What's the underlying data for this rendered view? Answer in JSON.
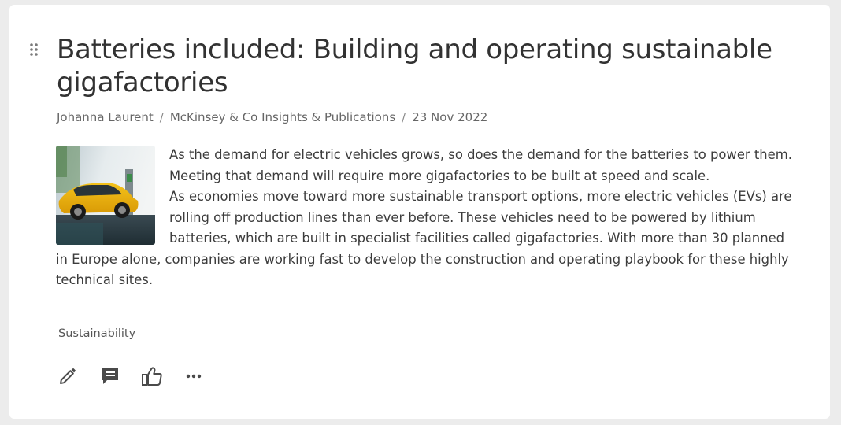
{
  "article": {
    "title": "Batteries included: Building and operating sustainable gigafactories",
    "meta": {
      "author": "Johanna Laurent",
      "source": "McKinsey & Co Insights & Publications",
      "date": "23 Nov 2022",
      "separator": "/"
    },
    "summary": "As the demand for electric vehicles grows, so does the demand for the batteries to power them. Meeting that demand will require more gigafactories to be built at speed and scale.",
    "body": "As economies move toward more sustainable transport options, more electric vehicles (EVs) are rolling off production lines than ever before. These vehicles need to be powered by lithium batteries, which are built in specialist facilities called gigafactories. With more than 30 planned in Europe alone, companies are working fast to develop the construction and operating playbook for these highly technical sites.",
    "tag": "Sustainability",
    "thumbnail_icon": "yellow-electric-car-charging-image"
  },
  "actions": {
    "edit_icon": "pencil-icon",
    "comment_icon": "comment-icon",
    "like_icon": "thumbs-up-icon",
    "more_icon": "more-horizontal-icon"
  },
  "colors": {
    "page_background": "#ececec",
    "card_background": "#ffffff",
    "title": "#323232",
    "icon": "#4a4a4a"
  }
}
